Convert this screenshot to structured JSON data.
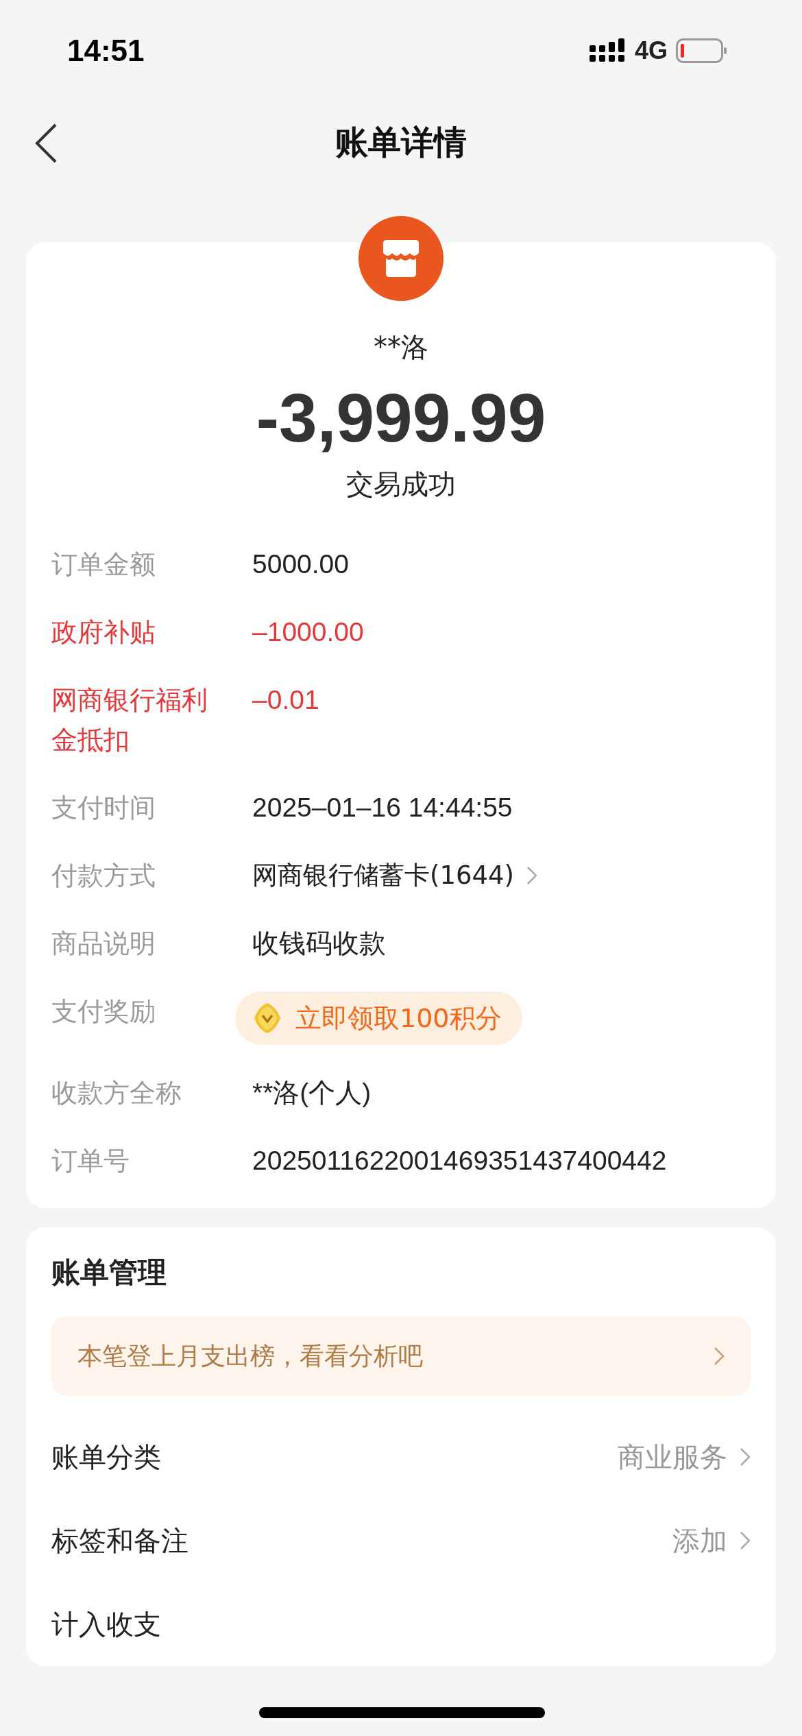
{
  "status_bar": {
    "time": "14:51",
    "network": "4G"
  },
  "nav": {
    "title": "账单详情"
  },
  "summary": {
    "payee": "**洛",
    "amount": "-3,999.99",
    "status": "交易成功"
  },
  "details": [
    {
      "label": "订单金额",
      "value": "5000.00",
      "kind": "text",
      "highlight": false
    },
    {
      "label": "政府补贴",
      "value": "–1000.00",
      "kind": "text",
      "highlight": true
    },
    {
      "label": "网商银行福利金抵扣",
      "value": "–0.01",
      "kind": "text",
      "highlight": true
    },
    {
      "label": "支付时间",
      "value": "2025–01–16 14:44:55",
      "kind": "text",
      "highlight": false
    },
    {
      "label": "付款方式",
      "value": "网商银行储蓄卡(1644)",
      "kind": "link",
      "highlight": false
    },
    {
      "label": "商品说明",
      "value": "收钱码收款",
      "kind": "text",
      "highlight": false
    },
    {
      "label": "支付奖励",
      "value": "立即领取100积分",
      "kind": "reward",
      "highlight": false
    },
    {
      "label": "收款方全称",
      "value": "**洛(个人)",
      "kind": "text",
      "highlight": false
    },
    {
      "label": "订单号",
      "value": "2025011622001469351437400442",
      "kind": "text",
      "highlight": false
    }
  ],
  "management": {
    "title": "账单管理",
    "banner": "本笔登上月支出榜，看看分析吧",
    "items": [
      {
        "label": "账单分类",
        "value": "商业服务"
      },
      {
        "label": "标签和备注",
        "value": "添加"
      },
      {
        "label": "计入收支"
      }
    ]
  }
}
